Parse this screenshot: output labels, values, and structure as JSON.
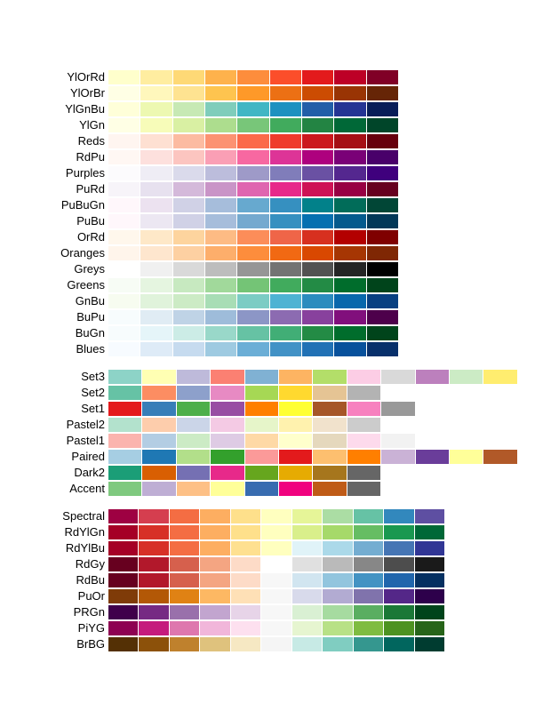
{
  "chart_data": [
    {
      "type": "table",
      "title": "Sequential palettes",
      "series": [
        {
          "name": "YlOrRd",
          "values": [
            "#FFFFCC",
            "#FFEDA0",
            "#FED976",
            "#FEB24C",
            "#FD8D3C",
            "#FC4E2A",
            "#E31A1C",
            "#BD0026",
            "#800026"
          ]
        },
        {
          "name": "YlOrBr",
          "values": [
            "#FFFFE5",
            "#FFF7BC",
            "#FEE391",
            "#FEC44F",
            "#FE9929",
            "#EC7014",
            "#CC4C02",
            "#993404",
            "#662506"
          ]
        },
        {
          "name": "YlGnBu",
          "values": [
            "#FFFFD9",
            "#EDF8B1",
            "#C7E9B4",
            "#7FCDBB",
            "#41B6C4",
            "#1D91C0",
            "#225EA8",
            "#253494",
            "#081D58"
          ]
        },
        {
          "name": "YlGn",
          "values": [
            "#FFFFE5",
            "#F7FCB9",
            "#D9F0A3",
            "#ADDD8E",
            "#78C679",
            "#41AB5D",
            "#238443",
            "#006837",
            "#004529"
          ]
        },
        {
          "name": "Reds",
          "values": [
            "#FFF5F0",
            "#FEE0D2",
            "#FCBBA1",
            "#FC9272",
            "#FB6A4A",
            "#EF3B2C",
            "#CB181D",
            "#A50F15",
            "#67000D"
          ]
        },
        {
          "name": "RdPu",
          "values": [
            "#FFF7F3",
            "#FDE0DD",
            "#FCC5C0",
            "#FA9FB5",
            "#F768A1",
            "#DD3497",
            "#AE017E",
            "#7A0177",
            "#49006A"
          ]
        },
        {
          "name": "Purples",
          "values": [
            "#FCFBFD",
            "#EFEDF5",
            "#DADAEB",
            "#BCBDDC",
            "#9E9AC8",
            "#807DBA",
            "#6A51A3",
            "#54278F",
            "#3F007D"
          ]
        },
        {
          "name": "PuRd",
          "values": [
            "#F7F4F9",
            "#E7E1EF",
            "#D4B9DA",
            "#C994C7",
            "#DF65B0",
            "#E7298A",
            "#CE1256",
            "#980043",
            "#67001F"
          ]
        },
        {
          "name": "PuBuGn",
          "values": [
            "#FFF7FB",
            "#ECE2F0",
            "#D0D1E6",
            "#A6BDDB",
            "#67A9CF",
            "#3690C0",
            "#02818A",
            "#016C59",
            "#014636"
          ]
        },
        {
          "name": "PuBu",
          "values": [
            "#FFF7FB",
            "#ECE7F2",
            "#D0D1E6",
            "#A6BDDB",
            "#74A9CF",
            "#3690C0",
            "#0570B0",
            "#045A8D",
            "#023858"
          ]
        },
        {
          "name": "OrRd",
          "values": [
            "#FFF7EC",
            "#FEE8C8",
            "#FDD49E",
            "#FDBB84",
            "#FC8D59",
            "#EF6548",
            "#D7301F",
            "#B30000",
            "#7F0000"
          ]
        },
        {
          "name": "Oranges",
          "values": [
            "#FFF5EB",
            "#FEE6CE",
            "#FDD0A2",
            "#FDAE6B",
            "#FD8D3C",
            "#F16913",
            "#D94801",
            "#A63603",
            "#7F2704"
          ]
        },
        {
          "name": "Greys",
          "values": [
            "#FFFFFF",
            "#F0F0F0",
            "#D9D9D9",
            "#BDBDBD",
            "#969696",
            "#737373",
            "#525252",
            "#252525",
            "#000000"
          ]
        },
        {
          "name": "Greens",
          "values": [
            "#F7FCF5",
            "#E5F5E0",
            "#C7E9C0",
            "#A1D99B",
            "#74C476",
            "#41AB5D",
            "#238B45",
            "#006D2C",
            "#00441B"
          ]
        },
        {
          "name": "GnBu",
          "values": [
            "#F7FCF0",
            "#E0F3DB",
            "#CCEBC5",
            "#A8DDB5",
            "#7BCCC4",
            "#4EB3D3",
            "#2B8CBE",
            "#0868AC",
            "#084081"
          ]
        },
        {
          "name": "BuPu",
          "values": [
            "#F7FCFD",
            "#E0ECF4",
            "#BFD3E6",
            "#9EBCDA",
            "#8C96C6",
            "#8C6BB1",
            "#88419D",
            "#810F7C",
            "#4D004B"
          ]
        },
        {
          "name": "BuGn",
          "values": [
            "#F7FCFD",
            "#E5F5F9",
            "#CCECE6",
            "#99D8C9",
            "#66C2A4",
            "#41AE76",
            "#238B45",
            "#006D2C",
            "#00441B"
          ]
        },
        {
          "name": "Blues",
          "values": [
            "#F7FBFF",
            "#DEEBF7",
            "#C6DBEF",
            "#9ECAE1",
            "#6BAED6",
            "#4292C6",
            "#2171B5",
            "#08519C",
            "#08306B"
          ]
        }
      ]
    },
    {
      "type": "table",
      "title": "Qualitative palettes",
      "series": [
        {
          "name": "Set3",
          "values": [
            "#8DD3C7",
            "#FFFFB3",
            "#BEBADA",
            "#FB8072",
            "#80B1D3",
            "#FDB462",
            "#B3DE69",
            "#FCCDE5",
            "#D9D9D9",
            "#BC80BD",
            "#CCEBC5",
            "#FFED6F"
          ]
        },
        {
          "name": "Set2",
          "values": [
            "#66C2A5",
            "#FC8D62",
            "#8DA0CB",
            "#E78AC3",
            "#A6D854",
            "#FFD92F",
            "#E5C494",
            "#B3B3B3"
          ]
        },
        {
          "name": "Set1",
          "values": [
            "#E41A1C",
            "#377EB8",
            "#4DAF4A",
            "#984EA3",
            "#FF7F00",
            "#FFFF33",
            "#A65628",
            "#F781BF",
            "#999999"
          ]
        },
        {
          "name": "Pastel2",
          "values": [
            "#B3E2CD",
            "#FDCDAC",
            "#CBD5E8",
            "#F4CAE4",
            "#E6F5C9",
            "#FFF2AE",
            "#F1E2CC",
            "#CCCCCC"
          ]
        },
        {
          "name": "Pastel1",
          "values": [
            "#FBB4AE",
            "#B3CDE3",
            "#CCEBC5",
            "#DECBE4",
            "#FED9A6",
            "#FFFFCC",
            "#E5D8BD",
            "#FDDAEC",
            "#F2F2F2"
          ]
        },
        {
          "name": "Paired",
          "values": [
            "#A6CEE3",
            "#1F78B4",
            "#B2DF8A",
            "#33A02C",
            "#FB9A99",
            "#E31A1C",
            "#FDBF6F",
            "#FF7F00",
            "#CAB2D6",
            "#6A3D9A",
            "#FFFF99",
            "#B15928"
          ]
        },
        {
          "name": "Dark2",
          "values": [
            "#1B9E77",
            "#D95F02",
            "#7570B3",
            "#E7298A",
            "#66A61E",
            "#E6AB02",
            "#A6761D",
            "#666666"
          ]
        },
        {
          "name": "Accent",
          "values": [
            "#7FC97F",
            "#BEAED4",
            "#FDC086",
            "#FFFF99",
            "#386CB0",
            "#F0027F",
            "#BF5B17",
            "#666666"
          ]
        }
      ]
    },
    {
      "type": "table",
      "title": "Diverging palettes",
      "series": [
        {
          "name": "Spectral",
          "values": [
            "#9E0142",
            "#D53E4F",
            "#F46D43",
            "#FDAE61",
            "#FEE08B",
            "#FFFFBF",
            "#E6F598",
            "#ABDDA4",
            "#66C2A5",
            "#3288BD",
            "#5E4FA2"
          ]
        },
        {
          "name": "RdYlGn",
          "values": [
            "#A50026",
            "#D73027",
            "#F46D43",
            "#FDAE61",
            "#FEE08B",
            "#FFFFBF",
            "#D9EF8B",
            "#A6D96A",
            "#66BD63",
            "#1A9850",
            "#006837"
          ]
        },
        {
          "name": "RdYlBu",
          "values": [
            "#A50026",
            "#D73027",
            "#F46D43",
            "#FDAE61",
            "#FEE090",
            "#FFFFBF",
            "#E0F3F8",
            "#ABD9E9",
            "#74ADD1",
            "#4575B4",
            "#313695"
          ]
        },
        {
          "name": "RdGy",
          "values": [
            "#67001F",
            "#B2182B",
            "#D6604D",
            "#F4A582",
            "#FDDBC7",
            "#FFFFFF",
            "#E0E0E0",
            "#BABABA",
            "#878787",
            "#4D4D4D",
            "#1A1A1A"
          ]
        },
        {
          "name": "RdBu",
          "values": [
            "#67001F",
            "#B2182B",
            "#D6604D",
            "#F4A582",
            "#FDDBC7",
            "#F7F7F7",
            "#D1E5F0",
            "#92C5DE",
            "#4393C3",
            "#2166AC",
            "#053061"
          ]
        },
        {
          "name": "PuOr",
          "values": [
            "#7F3B08",
            "#B35806",
            "#E08214",
            "#FDB863",
            "#FEE0B6",
            "#F7F7F7",
            "#D8DAEB",
            "#B2ABD2",
            "#8073AC",
            "#542788",
            "#2D004B"
          ]
        },
        {
          "name": "PRGn",
          "values": [
            "#40004B",
            "#762A83",
            "#9970AB",
            "#C2A5CF",
            "#E7D4E8",
            "#F7F7F7",
            "#D9F0D3",
            "#A6DBA0",
            "#5AAE61",
            "#1B7837",
            "#00441B"
          ]
        },
        {
          "name": "PiYG",
          "values": [
            "#8E0152",
            "#C51B7D",
            "#DE77AE",
            "#F1B6DA",
            "#FDE0EF",
            "#F7F7F7",
            "#E6F5D0",
            "#B8E186",
            "#7FBC41",
            "#4D9221",
            "#276419"
          ]
        },
        {
          "name": "BrBG",
          "values": [
            "#543005",
            "#8C510A",
            "#BF812D",
            "#DFC27D",
            "#F6E8C3",
            "#F5F5F5",
            "#C7EAE5",
            "#80CDC1",
            "#35978F",
            "#01665E",
            "#003C30"
          ]
        }
      ]
    }
  ]
}
